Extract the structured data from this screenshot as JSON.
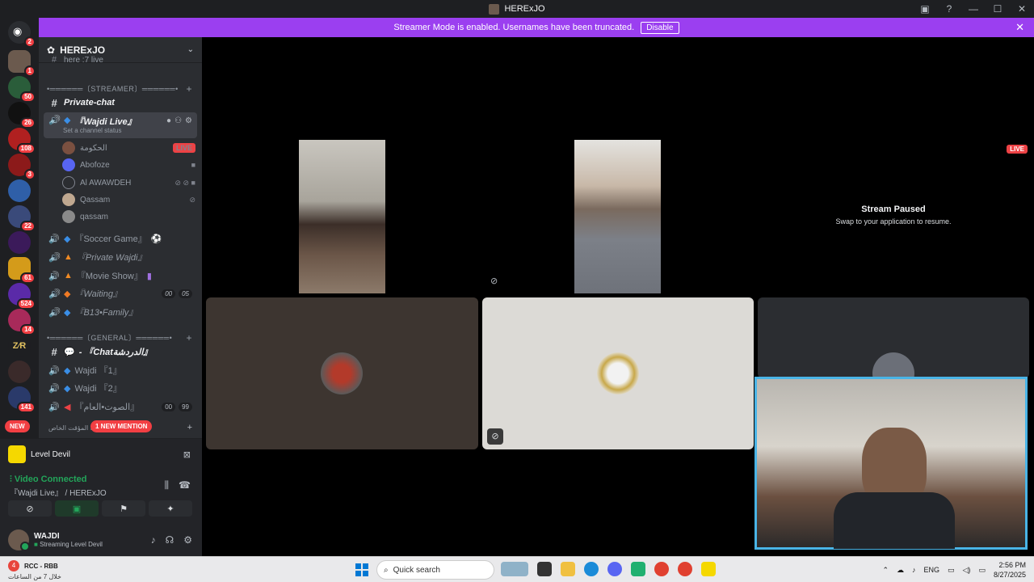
{
  "window": {
    "title": "HERExJO"
  },
  "banner": {
    "text": "Streamer Mode is enabled. Usernames have been truncated.",
    "disable_label": "Disable"
  },
  "rail": {
    "badges": [
      "2",
      "1",
      "50",
      "26",
      "108",
      "3",
      "22",
      "61",
      "524",
      "14",
      "141"
    ],
    "new_label": "NEW"
  },
  "server": {
    "name": "HERExJO",
    "top_partial": "here :7 live"
  },
  "categories": {
    "streamer": "•══════〔STREAMER〕══════•",
    "general": "•══════〔GENERAL〕══════•"
  },
  "channels": {
    "private_chat": "Private-chat",
    "wajdi_live": "『Wajdi Live』",
    "wajdi_live_status": "Set a channel status",
    "soccer": "『Soccer Game』",
    "private_wajdi": "『Private Wajdi』",
    "movie": "『Movie Show』",
    "waiting": "『Waiting』",
    "b13": "『B13•Family』",
    "chat": "- 『Chatالدردشة』",
    "wajdi1": "Wajdi 『1』",
    "wajdi2": "Wajdi 『2』",
    "voice_ar": "『الصوت•العام』",
    "private_ar": "رومك المؤقت الخاص"
  },
  "counts": {
    "waiting_a": "00",
    "waiting_b": "05",
    "voice_a": "00",
    "voice_b": "99"
  },
  "members": [
    {
      "name": "الحكومة",
      "live": "LIVE"
    },
    {
      "name": "Abofoze"
    },
    {
      "name": "Al AWAWDEH"
    },
    {
      "name": "Qassam"
    },
    {
      "name": "qassam"
    }
  ],
  "mention": "1 NEW MENTION",
  "activity": {
    "game": "Level Devil"
  },
  "voice": {
    "status": "Video Connected",
    "channel": "『Wajdi Live』 / HERExJO"
  },
  "user": {
    "name": "WAJDI",
    "status": "Streaming Level Devil"
  },
  "stage": {
    "paused_title": "Stream Paused",
    "paused_sub": "Swap to your application to resume.",
    "live": "LIVE"
  },
  "taskbar": {
    "weather_title": "RCC - RBB",
    "weather_sub": "خلال 7 من الساعات",
    "weather_badge": "4",
    "search_placeholder": "Quick search",
    "lang": "ENG",
    "time": "2:56 PM",
    "date": "8/27/2025"
  },
  "colors": {
    "banner": "#9b3ff0",
    "live": "#ed4245",
    "connected": "#23a55a",
    "pip_border": "#49b4e6"
  }
}
